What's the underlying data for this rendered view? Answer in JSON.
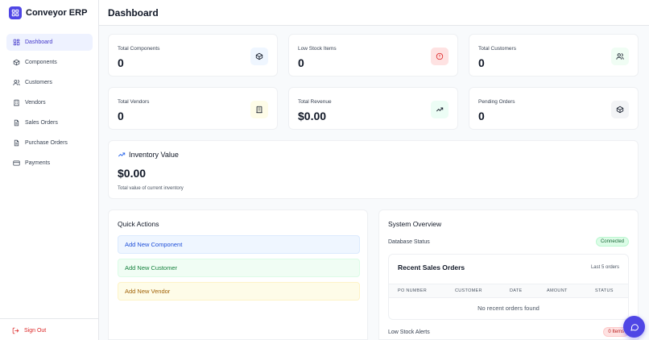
{
  "app": {
    "name": "Conveyor ERP"
  },
  "sidebar": {
    "items": [
      {
        "label": "Dashboard",
        "icon": "dashboard-icon",
        "active": true
      },
      {
        "label": "Components",
        "icon": "box-icon"
      },
      {
        "label": "Customers",
        "icon": "users-icon"
      },
      {
        "label": "Vendors",
        "icon": "building-icon"
      },
      {
        "label": "Sales Orders",
        "icon": "document-icon"
      },
      {
        "label": "Purchase Orders",
        "icon": "document-icon"
      },
      {
        "label": "Payments",
        "icon": "credit-card-icon"
      }
    ],
    "sign_out": "Sign Out"
  },
  "header": {
    "title": "Dashboard"
  },
  "stats": [
    {
      "label": "Total Components",
      "value": "0",
      "icon": "box-icon",
      "icon_bg": "#eff6ff",
      "icon_color": "#111827"
    },
    {
      "label": "Low Stock Items",
      "value": "0",
      "icon": "alert-circle-icon",
      "icon_bg": "#fee2e2",
      "icon_color": "#dc2626"
    },
    {
      "label": "Total Customers",
      "value": "0",
      "icon": "users-icon",
      "icon_bg": "#f0fdf4",
      "icon_color": "#111827"
    },
    {
      "label": "Total Vendors",
      "value": "0",
      "icon": "building-icon",
      "icon_bg": "#fefce8",
      "icon_color": "#111827"
    },
    {
      "label": "Total Revenue",
      "value": "$0.00",
      "icon": "trending-up-icon",
      "icon_bg": "#ecfdf5",
      "icon_color": "#111827"
    },
    {
      "label": "Pending Orders",
      "value": "0",
      "icon": "box-icon",
      "icon_bg": "#f3f4f6",
      "icon_color": "#111827"
    }
  ],
  "inventory": {
    "title": "Inventory Value",
    "value": "$0.00",
    "subtitle": "Total value of current inventory"
  },
  "quick_actions": {
    "title": "Quick Actions",
    "buttons": [
      "Add New Component",
      "Add New Customer",
      "Add New Vendor"
    ]
  },
  "system_overview": {
    "title": "System Overview",
    "db_label": "Database Status",
    "db_status": "Connected",
    "recent_orders": {
      "title": "Recent Sales Orders",
      "subtitle": "Last 5 orders",
      "columns": [
        "PO NUMBER",
        "CUSTOMER",
        "DATE",
        "AMOUNT",
        "STATUS"
      ],
      "empty": "No recent orders found"
    },
    "low_stock_label": "Low Stock Alerts",
    "low_stock_badge": "0 Items"
  },
  "colors": {
    "accent": "#4f46e5",
    "danger": "#dc2626",
    "success": "#16a34a"
  }
}
